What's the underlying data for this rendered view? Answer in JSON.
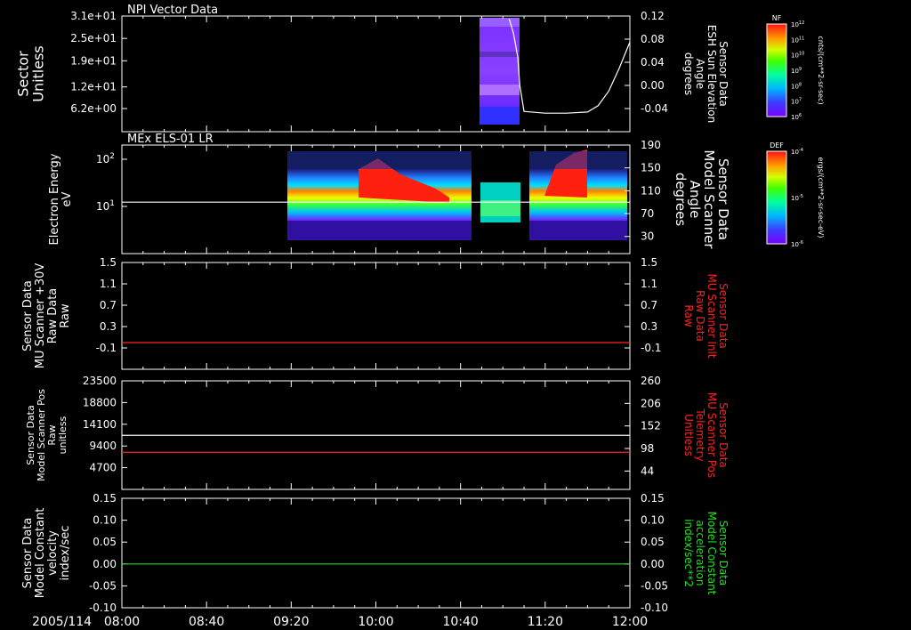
{
  "colors": {
    "background": "#000000",
    "frame": "#ffffff",
    "red_trace": "#ff2020",
    "green_trace": "#20e020",
    "white_trace": "#ffffff"
  },
  "time_axis": {
    "date_label": "2005/114",
    "tick_labels": [
      "08:00",
      "08:40",
      "09:20",
      "10:00",
      "10:40",
      "11:20",
      "12:00"
    ],
    "start": "08:00",
    "end": "12:00",
    "minor_tick_minutes": 10
  },
  "colorbars": [
    {
      "title": "NF",
      "unit_label": "cnts/(cm**2-sr-sec)",
      "tick_labels": [
        "10^12",
        "10^11",
        "10^10",
        "10^9",
        "10^8",
        "10^7",
        "10^6"
      ],
      "scale": "log"
    },
    {
      "title": "DEF",
      "unit_label": "ergs/(cm**2-sr-sec-eV)",
      "tick_labels": [
        "10^-4",
        "10^-5",
        "10^-6"
      ],
      "scale": "log"
    }
  ],
  "chart_data": [
    {
      "type": "heatmap",
      "title": "NPI Vector Data",
      "ylabel_left": [
        "Sector",
        "Unitless"
      ],
      "ylabel_right": [
        "Sensor Data",
        "ESH Sun Elevation",
        "Angle",
        "degrees"
      ],
      "yticks_left": [
        "3.1e+01",
        "2.5e+01",
        "1.9e+01",
        "1.2e+01",
        "6.2e+00"
      ],
      "yticks_right": [
        "0.12",
        "0.08",
        "0.04",
        "0.00",
        "-0.04"
      ],
      "ylim_left": [
        0,
        31
      ],
      "ylim_right": [
        -0.08,
        0.12
      ],
      "spectrogram_time_range": [
        "10:50",
        "11:05"
      ],
      "sun_elevation_series": {
        "name": "",
        "x": [
          "11:03",
          "11:05",
          "11:07",
          "11:08",
          "11:10",
          "11:20",
          "11:30",
          "11:40",
          "11:45",
          "11:50",
          "11:55",
          "12:00"
        ],
        "values": [
          0.115,
          0.09,
          0.05,
          0.0,
          -0.045,
          -0.048,
          -0.048,
          -0.046,
          -0.035,
          -0.01,
          0.03,
          0.075
        ]
      }
    },
    {
      "type": "heatmap",
      "title": "MEx ELS-01 LR",
      "ylabel_left": [
        "Electron Energy",
        "eV"
      ],
      "ylabel_right": [
        "Sensor Data",
        "Model Scanner",
        "Angle",
        "degrees"
      ],
      "yticks_left": [
        "10^2",
        "10^1"
      ],
      "yticks_right": [
        "190",
        "150",
        "110",
        "70",
        "30"
      ],
      "ylim_left": [
        1,
        200
      ],
      "ylim_right": [
        0,
        190
      ],
      "yscale_left": "log",
      "spectrogram_time_range": [
        "09:18",
        "12:00"
      ],
      "scanner_angle_series": {
        "name": "",
        "x": [
          "08:00",
          "12:00"
        ],
        "values": [
          90,
          90
        ]
      }
    },
    {
      "type": "line",
      "title": "",
      "ylabel_left": [
        "Sensor Data",
        "MU Scanner +30V",
        "Raw Data",
        "Raw"
      ],
      "ylabel_right": [
        "Sensor Data",
        "MU Scanner Inlt",
        "Raw Data",
        "Raw"
      ],
      "yticks_left": [
        "1.5",
        "1.1",
        "0.7",
        "0.3",
        "-0.1"
      ],
      "yticks_right": [
        "1.5",
        "1.1",
        "0.7",
        "0.3",
        "-0.1"
      ],
      "ylim": [
        -0.5,
        1.5
      ],
      "series": [
        {
          "name": "",
          "color": "#ff2020",
          "x": [
            "08:00",
            "12:00"
          ],
          "values": [
            0.0,
            0.0
          ]
        }
      ]
    },
    {
      "type": "line",
      "title": "",
      "ylabel_left": [
        "Sensor Data",
        "Model Scanner Pos",
        "Raw",
        "unitless"
      ],
      "ylabel_right": [
        "Sensor Data",
        "MU Scanner Pos",
        "Telemetry",
        "Unitless"
      ],
      "yticks_left": [
        "23500",
        "18800",
        "14100",
        "9400",
        "4700"
      ],
      "yticks_right": [
        "260",
        "206",
        "152",
        "98",
        "44"
      ],
      "ylim_left": [
        0,
        23500
      ],
      "ylim_right": [
        0,
        260
      ],
      "series": [
        {
          "name": "",
          "color": "#ffffff",
          "axis": "left",
          "x": [
            "08:00",
            "12:00"
          ],
          "values": [
            11700,
            11700
          ]
        },
        {
          "name": "",
          "color": "#ff2020",
          "axis": "right",
          "x": [
            "08:00",
            "12:00"
          ],
          "values": [
            89,
            89
          ]
        }
      ]
    },
    {
      "type": "line",
      "title": "",
      "ylabel_left": [
        "Sensor Data",
        "Model Constant",
        "velocity",
        "index/sec"
      ],
      "ylabel_right": [
        "Sensor Data",
        "Model Constant",
        "acceleration",
        "index/sec**2"
      ],
      "yticks_left": [
        "0.15",
        "0.10",
        "0.05",
        "0.00",
        "-0.05",
        "-0.10"
      ],
      "yticks_right": [
        "0.15",
        "0.10",
        "0.05",
        "0.00",
        "-0.05",
        "-0.10"
      ],
      "ylim": [
        -0.1,
        0.15
      ],
      "series": [
        {
          "name": "",
          "color": "#20e020",
          "x": [
            "08:00",
            "12:00"
          ],
          "values": [
            0.0,
            0.0
          ]
        }
      ]
    }
  ]
}
